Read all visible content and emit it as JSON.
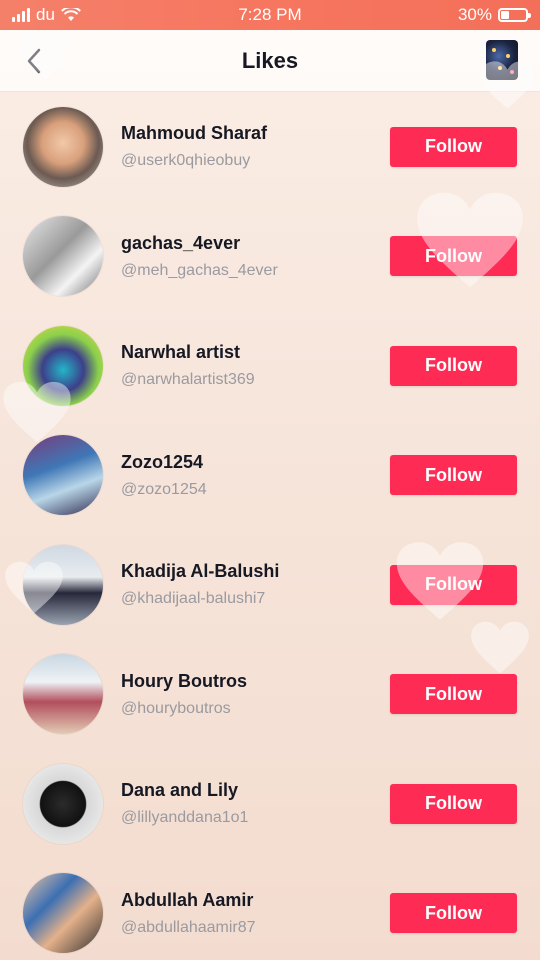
{
  "status": {
    "carrier": "du",
    "time": "7:28 PM",
    "battery": "30%",
    "battery_level": 0.3
  },
  "header": {
    "title": "Likes",
    "back_icon": "chevron-left-icon",
    "thumb_icon": "video-thumbnail"
  },
  "users": [
    {
      "name": "Mahmoud Sharaf",
      "handle": "@userk0qhieobuy",
      "follow_label": "Follow"
    },
    {
      "name": "gachas_4ever",
      "handle": "@meh_gachas_4ever",
      "follow_label": "Follow"
    },
    {
      "name": "Narwhal artist",
      "handle": "@narwhalartist369",
      "follow_label": "Follow"
    },
    {
      "name": "Zozo1254",
      "handle": "@zozo1254",
      "follow_label": "Follow"
    },
    {
      "name": "Khadija Al-Balushi",
      "handle": "@khadijaal-balushi7",
      "follow_label": "Follow"
    },
    {
      "name": "Houry Boutros",
      "handle": "@houryboutros",
      "follow_label": "Follow"
    },
    {
      "name": "Dana and Lily",
      "handle": "@lillyanddana1o1",
      "follow_label": "Follow"
    },
    {
      "name": "Abdullah Aamir",
      "handle": "@abdullahaamir87",
      "follow_label": "Follow"
    }
  ],
  "colors": {
    "follow_button": "#fe2c55",
    "status_bar": "#f5806a",
    "text_primary": "#161823",
    "text_secondary": "#9a9aa0"
  }
}
